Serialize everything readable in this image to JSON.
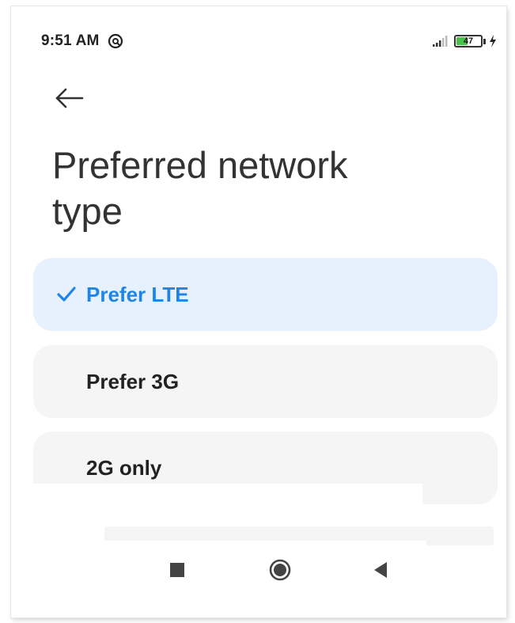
{
  "status_bar": {
    "time": "9:51 AM",
    "battery_level": "47",
    "battery_fraction": 0.47,
    "icons": [
      "at-sign-icon",
      "signal-icon",
      "battery-icon",
      "charging-bolt-icon"
    ]
  },
  "header": {
    "back_icon": "back-arrow-icon",
    "title": "Preferred network type"
  },
  "options": [
    {
      "label": "Prefer LTE",
      "selected": true
    },
    {
      "label": "Prefer 3G",
      "selected": false
    },
    {
      "label": "2G only",
      "selected": false
    }
  ],
  "nav_bar": {
    "icons": [
      "recents-square-icon",
      "home-circle-icon",
      "back-triangle-icon"
    ]
  },
  "colors": {
    "accent": "#1e84e6",
    "selected_bg": "#e6f1fd",
    "option_bg": "#f5f5f5",
    "battery_green": "#49c44a"
  }
}
